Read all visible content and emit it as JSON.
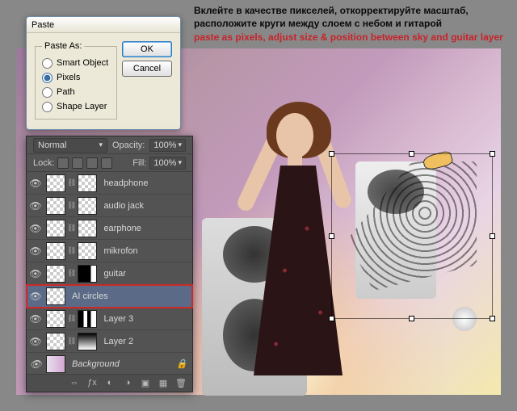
{
  "caption": {
    "ru": "Вклейте в качестве пикселей, откорректируйте масштаб, расположите круги между слоем с небом и гитарой",
    "en": "paste as pixels, adjust size & position between sky and guitar layer"
  },
  "dialog": {
    "title": "Paste",
    "legend": "Paste As:",
    "options": {
      "smart_object": "Smart Object",
      "pixels": "Pixels",
      "path": "Path",
      "shape_layer": "Shape Layer"
    },
    "selected": "pixels",
    "ok": "OK",
    "cancel": "Cancel"
  },
  "panel": {
    "blend_mode": "Normal",
    "opacity_label": "Opacity:",
    "opacity_value": "100%",
    "lock_label": "Lock:",
    "fill_label": "Fill:",
    "fill_value": "100%",
    "layers": [
      {
        "name": "headphone",
        "thumbs": [
          "checker",
          "checker"
        ],
        "chain": true
      },
      {
        "name": "audio jack",
        "thumbs": [
          "checker",
          "checker"
        ],
        "chain": true
      },
      {
        "name": "earphone",
        "thumbs": [
          "checker",
          "checker"
        ],
        "chain": true
      },
      {
        "name": "mikrofon",
        "thumbs": [
          "checker",
          "checker"
        ],
        "chain": true
      },
      {
        "name": "guitar",
        "thumbs": [
          "checker",
          "mask"
        ],
        "chain": true
      },
      {
        "name": "AI circles",
        "thumbs": [
          "checker"
        ],
        "selected": true
      },
      {
        "name": "Layer 3",
        "thumbs": [
          "checker",
          "mask3"
        ],
        "chain": true
      },
      {
        "name": "Layer 2",
        "thumbs": [
          "checker",
          "mask2"
        ],
        "chain": true
      },
      {
        "name": "Background",
        "thumbs": [
          "grad"
        ],
        "bg": true
      }
    ]
  }
}
